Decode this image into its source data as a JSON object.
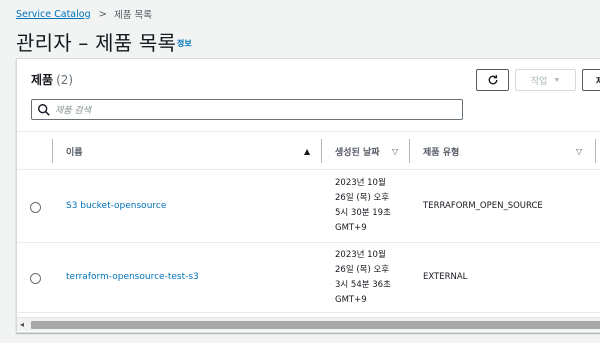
{
  "breadcrumb": {
    "root_label": "Service Catalog",
    "separator": ">",
    "current_label": "제품 목록"
  },
  "header": {
    "title": "관리자 – 제품 목록",
    "info_label": "정보"
  },
  "products_panel": {
    "title": "제품",
    "count": "(2)",
    "refresh_icon": "refresh-icon",
    "actions_label": "작업",
    "actions_caret": "▼",
    "more_label": "제"
  },
  "search": {
    "placeholder": "제품 검색",
    "icon": "search-icon"
  },
  "table": {
    "columns": [
      {
        "label": "이름",
        "sort": "▲"
      },
      {
        "label": "생성된 날짜",
        "sort": "▽"
      },
      {
        "label": "제품 유형",
        "sort": "▽"
      }
    ],
    "rows": [
      {
        "name": "S3 bucket-opensource",
        "date_lines": [
          "2023년 10월",
          "26일 (목) 오후",
          "5시 30분 19초",
          "GMT+9"
        ],
        "type": "TERRAFORM_OPEN_SOURCE"
      },
      {
        "name": "terraform-opensource-test-s3",
        "date_lines": [
          "2023년 10월",
          "26일 (목) 오후",
          "3시 54분 36초",
          "GMT+9"
        ],
        "type": "EXTERNAL"
      }
    ]
  },
  "scrollbar": {
    "left_arrow": "◂"
  },
  "colors": {
    "link": "#0073bb",
    "background": "#f2f3f3",
    "text": "#16191f"
  }
}
